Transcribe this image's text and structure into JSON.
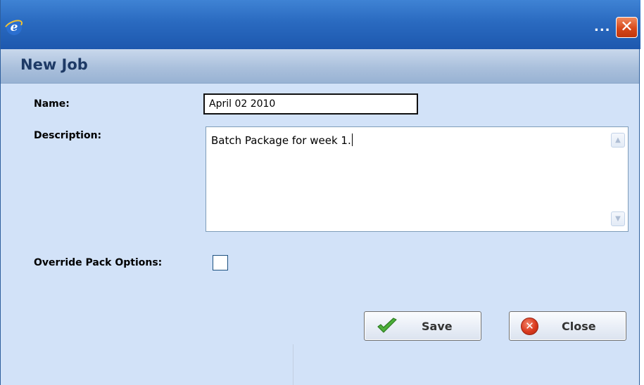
{
  "titlebar": {
    "logo_letter": "e",
    "overflow_label": "...",
    "close_glyph": "✕"
  },
  "panel": {
    "title": "New Job"
  },
  "form": {
    "name_label": "Name:",
    "name_value": "April 02 2010",
    "description_label": "Description:",
    "description_value": "Batch Package for week 1.",
    "override_label": "Override Pack Options:",
    "override_checked": false
  },
  "scrollbar": {
    "up_glyph": "▲",
    "down_glyph": "▼"
  },
  "buttons": {
    "save_label": "Save",
    "close_label": "Close",
    "close_icon_glyph": "✕"
  },
  "colors": {
    "titlebar": "#2a6ac0",
    "panel_background": "#d2e2f8",
    "header_background": "#aac0dc",
    "close_red": "#d7491b",
    "save_green": "#3c9a2a"
  }
}
